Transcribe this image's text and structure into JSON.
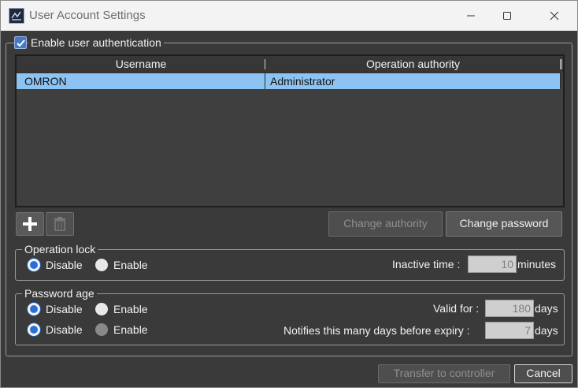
{
  "window": {
    "title": "User Account Settings",
    "icon": "app-icon"
  },
  "auth": {
    "enable_label": "Enable user authentication",
    "checked": true
  },
  "table": {
    "columns": [
      "Username",
      "Operation authority"
    ],
    "rows": [
      {
        "username": "OMRON",
        "authority": "Administrator",
        "selected": true
      }
    ]
  },
  "toolbar": {
    "add_icon": "plus-icon",
    "delete_icon": "trash-icon",
    "change_authority": "Change authority",
    "change_password": "Change password"
  },
  "operation_lock": {
    "legend": "Operation lock",
    "disable_label": "Disable",
    "enable_label": "Enable",
    "selected": "Disable",
    "inactive_time_label": "Inactive time :",
    "inactive_time_value": "10",
    "inactive_time_unit": "minutes"
  },
  "password_age": {
    "legend": "Password age",
    "row1": {
      "disable_label": "Disable",
      "enable_label": "Enable",
      "selected": "Disable",
      "valid_for_label": "Valid for :",
      "valid_for_value": "180",
      "valid_for_unit": "days"
    },
    "row2": {
      "disable_label": "Disable",
      "enable_label": "Enable",
      "selected": "Disable",
      "notify_label": "Notifies this many days before expiry :",
      "notify_value": "7",
      "notify_unit": "days"
    }
  },
  "footer": {
    "transfer": "Transfer to controller",
    "cancel": "Cancel"
  },
  "colors": {
    "background": "#3a3a3a",
    "selection": "#8cc3f3",
    "accent": "#2a6fd6"
  }
}
